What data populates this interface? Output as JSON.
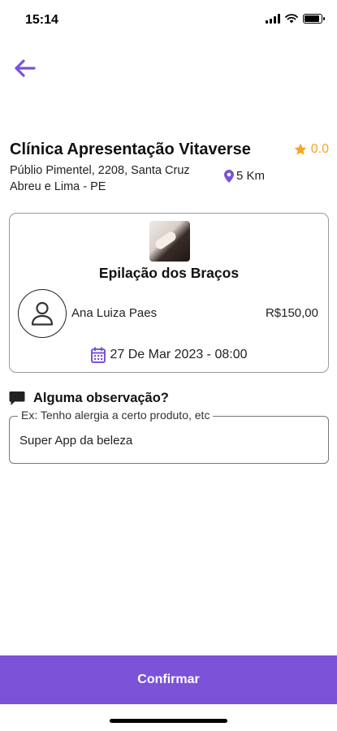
{
  "status_bar": {
    "time": "15:14",
    "battery_level": 0.9
  },
  "nav": {
    "back_icon": "arrow-left-icon"
  },
  "clinic": {
    "name": "Clínica Apresentação Vitaverse",
    "rating": "0.0",
    "address_line1": "Públio Pimentel, 2208, Santa Cruz",
    "address_line2": "Abreu e Lima - PE",
    "distance": "5 Km"
  },
  "service": {
    "title": "Epilação dos Braços",
    "professional": "Ana Luiza Paes",
    "price": "R$150,00",
    "datetime": "27 De Mar 2023 - 08:00"
  },
  "observation": {
    "heading": "Alguma observação?",
    "placeholder": "Ex: Tenho alergia a certo produto, etc",
    "value": "Super App da beleza"
  },
  "actions": {
    "confirm_label": "Confirmar"
  },
  "colors": {
    "accent": "#7b52d8",
    "star": "#f5a623"
  }
}
